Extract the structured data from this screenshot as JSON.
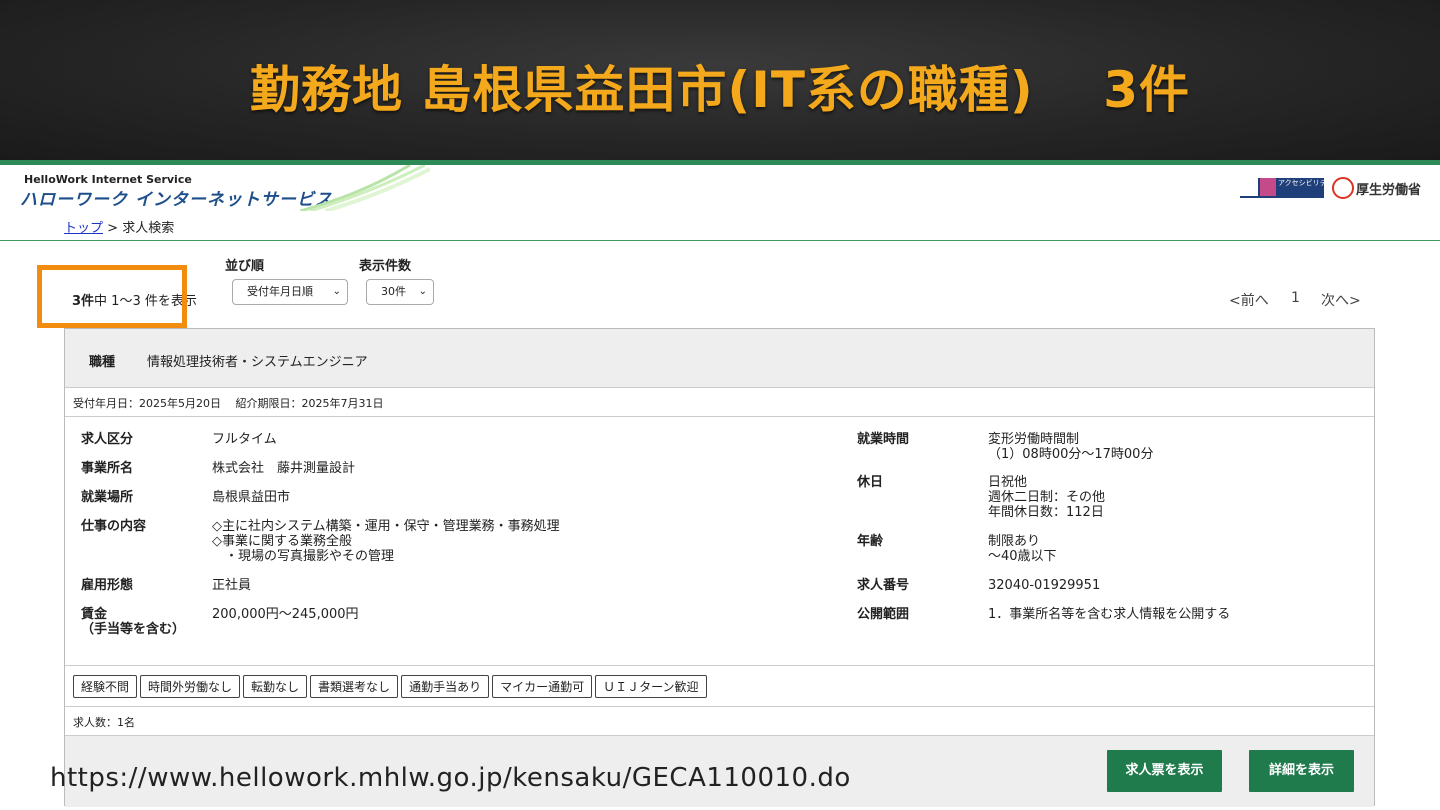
{
  "slide": {
    "title_main": "勤務地 島根県益田市(IT系の職種)",
    "title_count": "3件",
    "url": "https://www.hellowork.mhlw.go.jp/kensaku/GECA110010.do"
  },
  "header": {
    "logo_small": "HelloWork Internet Service",
    "logo_big": "ハローワーク インターネットサービス",
    "accessibility_text": "アクセシビリティ 閲覧支援ツール",
    "ministry": "厚生労働省",
    "colors": {
      "accent_green": "#2e8b57",
      "brand_blue": "#1f4f8b",
      "title_orange": "#f4a81c"
    }
  },
  "breadcrumb": {
    "top": "トップ",
    "sep": ">",
    "current": "求人検索"
  },
  "controls": {
    "sort_label": "並び順",
    "sort_value": "受付年月日順",
    "per_page_label": "表示件数",
    "per_page_value": "30件",
    "count_total": "3件",
    "count_rest": "中 1〜3 件を表示",
    "pager_prev": "<前へ",
    "pager_page": "1",
    "pager_next": "次へ>"
  },
  "job": {
    "category_label": "職種",
    "category_value": "情報処理技術者・システムエンジニア",
    "dates": "受付年月日：2025年5月20日　 紹介期限日：2025年7月31日",
    "left": [
      {
        "label": "求人区分",
        "value": "フルタイム"
      },
      {
        "label": "事業所名",
        "value": "株式会社　藤井測量設計"
      },
      {
        "label": "就業場所",
        "value": "島根県益田市"
      },
      {
        "label": "仕事の内容",
        "value": "◇主に社内システム構築・運用・保守・管理業務・事務処理\n◇事業に関する業務全般\n　・現場の写真撮影やその管理"
      },
      {
        "label": "雇用形態",
        "value": "正社員"
      },
      {
        "label": "賃金\n（手当等を含む）",
        "value": "200,000円〜245,000円"
      }
    ],
    "right": [
      {
        "label": "就業時間",
        "value": "変形労働時間制\n（1）08時00分〜17時00分"
      },
      {
        "label": "休日",
        "value": "日祝他\n週休二日制：その他\n年間休日数：112日"
      },
      {
        "label": "年齢",
        "value": "制限あり\n〜40歳以下"
      },
      {
        "label": "求人番号",
        "value": "32040-01929951"
      },
      {
        "label": "公開範囲",
        "value": "1．事業所名等を含む求人情報を公開する"
      }
    ],
    "tags": [
      "経験不問",
      "時間外労働なし",
      "転勤なし",
      "書類選考なし",
      "通勤手当あり",
      "マイカー通勤可",
      "ＵＩＪターン歓迎"
    ],
    "headcount": "求人数：1名",
    "btn_ticket": "求人票を表示",
    "btn_detail": "詳細を表示"
  }
}
